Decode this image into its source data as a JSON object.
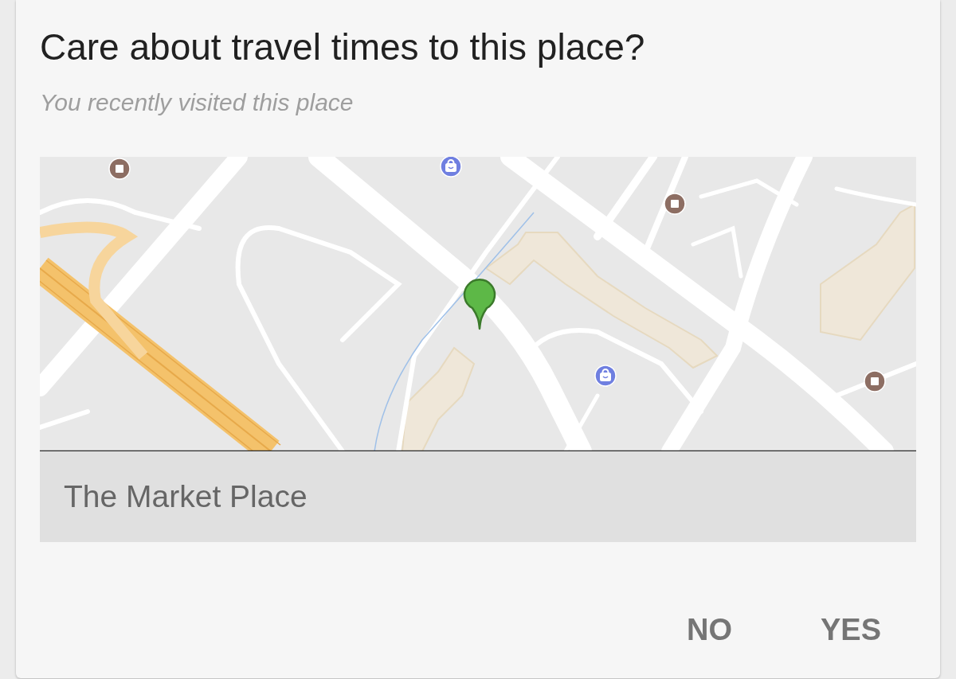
{
  "dialog": {
    "title": "Care about travel times to this place?",
    "subtitle": "You recently visited this place",
    "place_name": "The Market Place",
    "buttons": [
      {
        "label": "NO"
      },
      {
        "label": "YES"
      }
    ]
  }
}
